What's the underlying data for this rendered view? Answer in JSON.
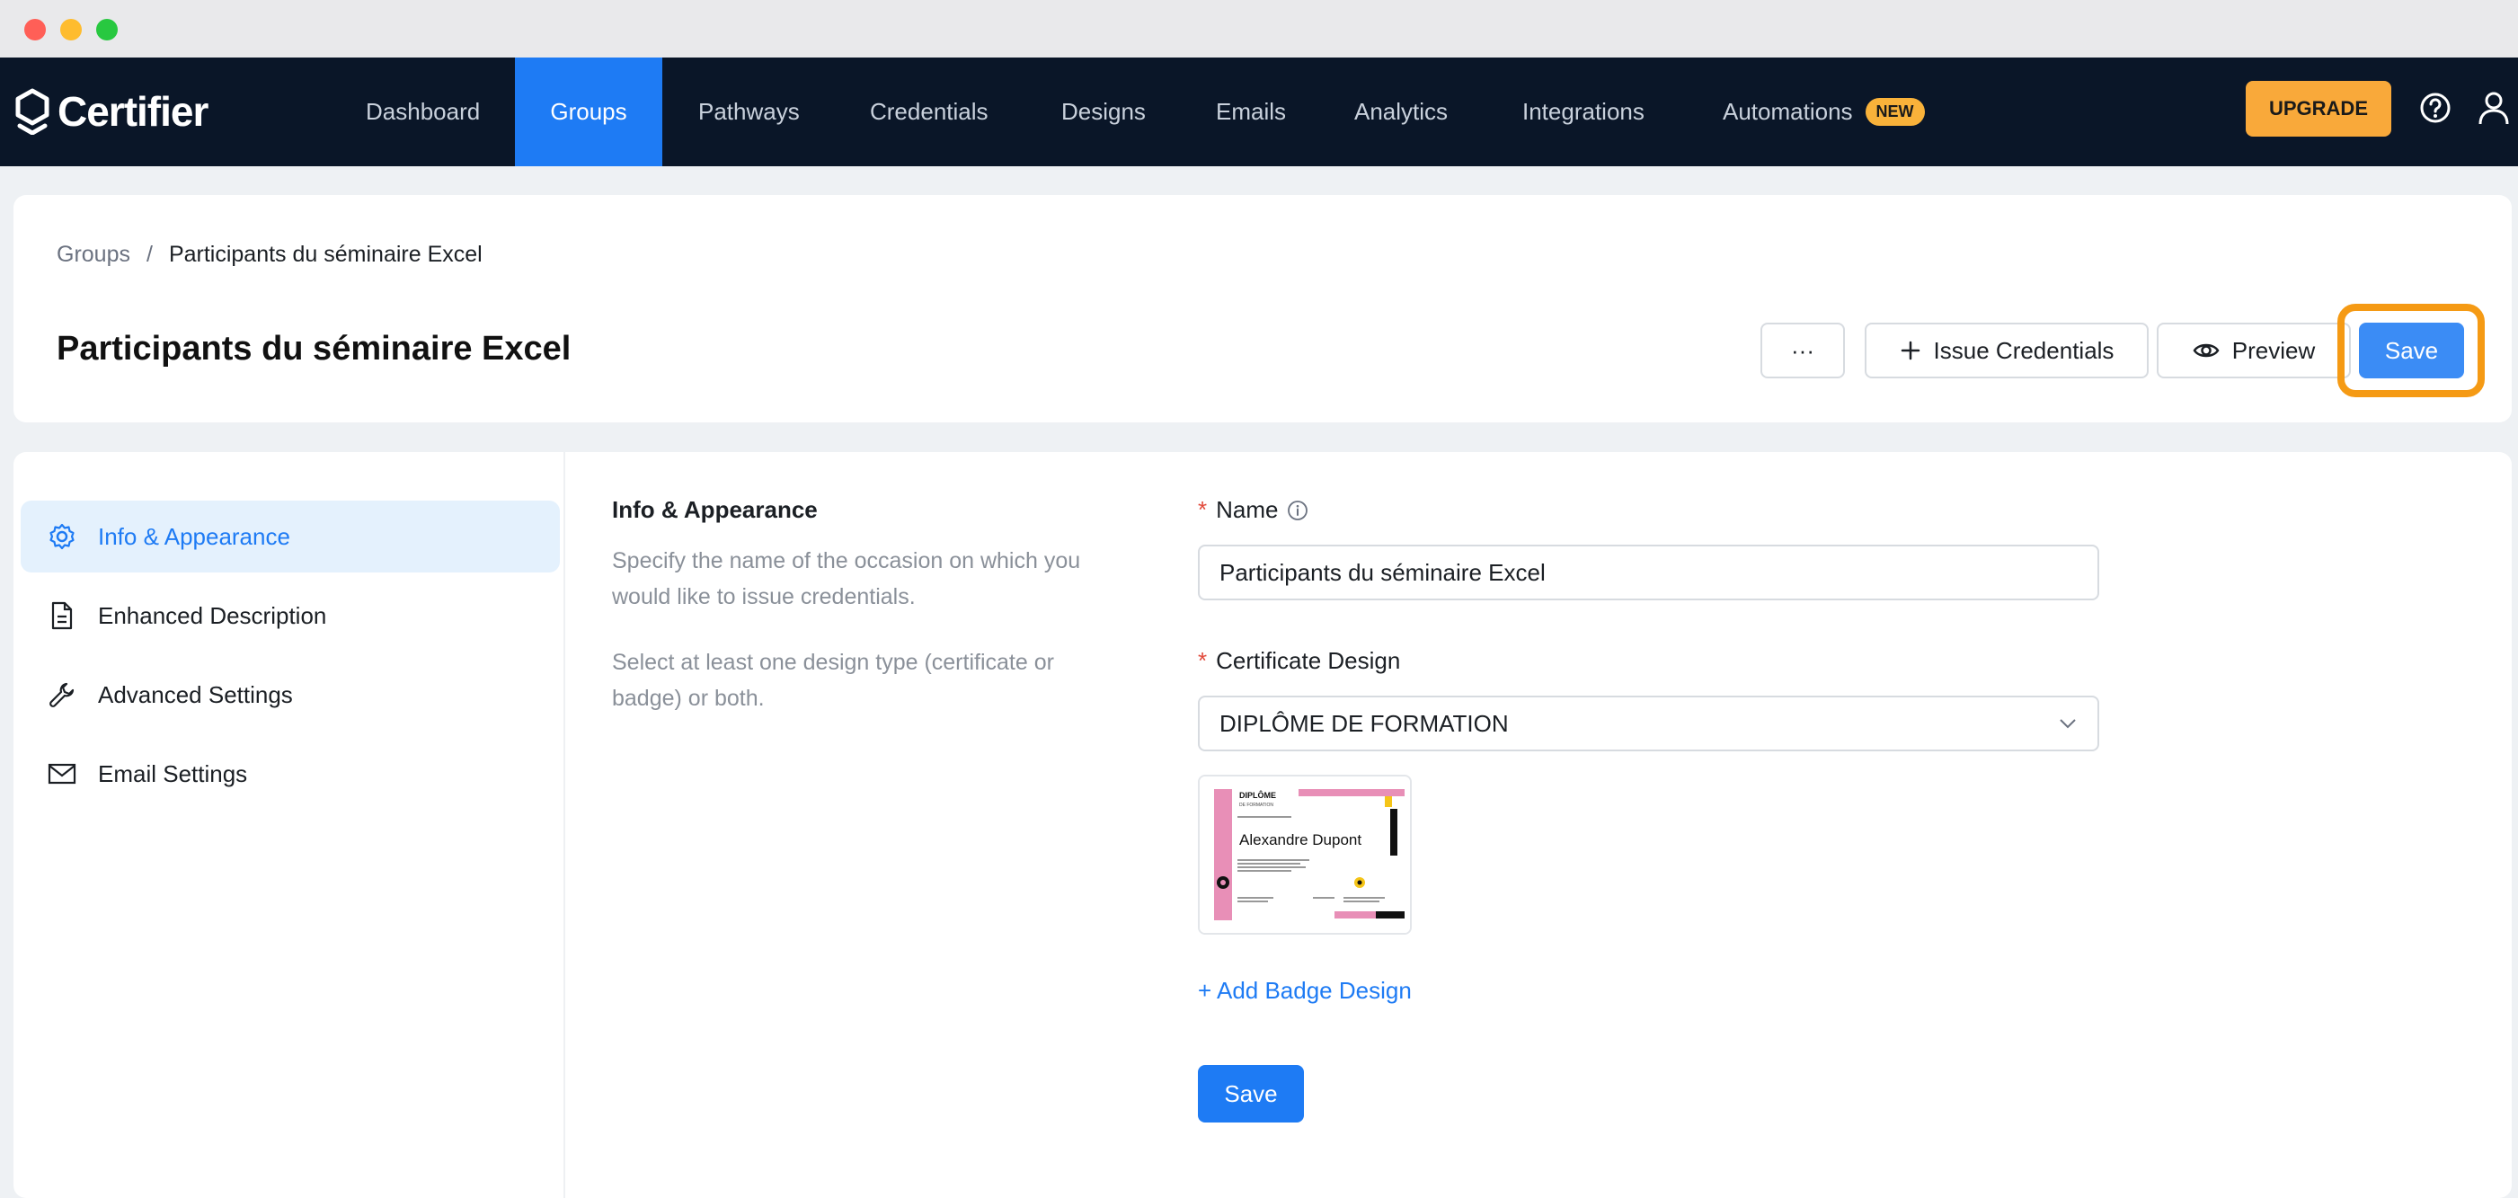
{
  "nav": {
    "brand": "Certifier",
    "items": [
      {
        "label": "Dashboard"
      },
      {
        "label": "Groups"
      },
      {
        "label": "Pathways"
      },
      {
        "label": "Credentials"
      },
      {
        "label": "Designs"
      },
      {
        "label": "Emails"
      },
      {
        "label": "Analytics"
      },
      {
        "label": "Integrations"
      },
      {
        "label": "Automations",
        "badge": "NEW"
      }
    ],
    "active": "Groups",
    "upgrade_label": "UPGRADE"
  },
  "header": {
    "breadcrumb": [
      "Groups",
      "/",
      "Participants du séminaire Excel"
    ],
    "title": "Participants du séminaire Excel",
    "more_label": "···",
    "issue_label": "Issue Credentials",
    "preview_label": "Preview",
    "save_label": "Save"
  },
  "sidebar": {
    "items": [
      {
        "label": "Info & Appearance",
        "icon": "gear-icon",
        "active": true
      },
      {
        "label": "Enhanced Description",
        "icon": "document-icon",
        "active": false
      },
      {
        "label": "Advanced Settings",
        "icon": "wrench-icon",
        "active": false
      },
      {
        "label": "Email Settings",
        "icon": "envelope-icon",
        "active": false
      }
    ]
  },
  "section": {
    "title": "Info & Appearance",
    "desc1": "Specify the name of the occasion on which you would like to issue credentials.",
    "desc2": "Select at least one design type (certificate or badge) or both."
  },
  "form": {
    "name_label": "Name",
    "name_value": "Participants du séminaire Excel",
    "design_label": "Certificate Design",
    "design_value": "DIPLÔME DE FORMATION",
    "preview": {
      "title": "DIPLÔME",
      "subtitle": "DE FORMATION",
      "recipient": "Alexandre Dupont"
    },
    "add_badge_label": "+ Add Badge Design",
    "save_label": "Save"
  },
  "colors": {
    "nav_bg": "#0a1628",
    "accent": "#1e7bf4",
    "upgrade": "#f9a93a",
    "highlight": "#f59a14",
    "required": "#e24a3b"
  }
}
